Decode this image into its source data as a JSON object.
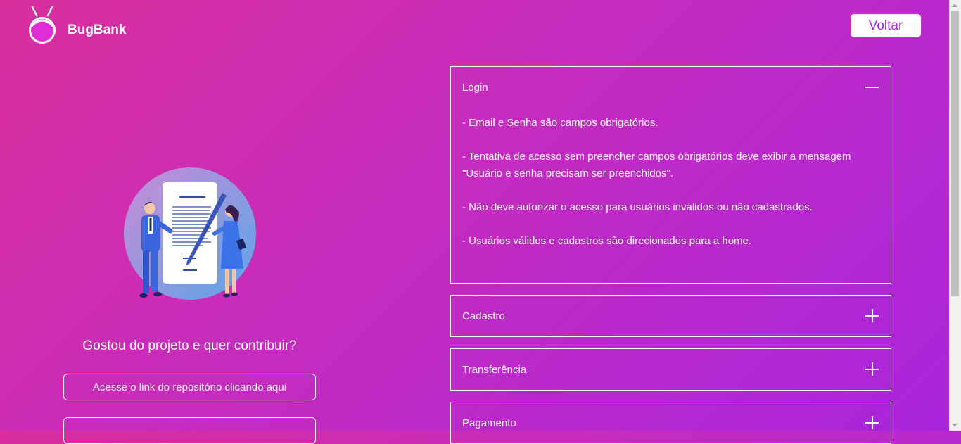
{
  "header": {
    "brand": "BugBank",
    "back_label": "Voltar"
  },
  "left": {
    "illustration": "document-signing-illustration",
    "contribute_title": "Gostou do projeto e quer contribuir?",
    "repo_link_label": "Acesse o link do repositório clicando aqui"
  },
  "accordion": [
    {
      "title": "Login",
      "expanded": true,
      "icon": "minus-icon",
      "items": [
        "- Email e Senha são campos obrigatórios.",
        "- Tentativa de acesso sem preencher campos obrigatórios deve exibir a mensagem \"Usuário e senha precisam ser preenchidos\".",
        "- Não deve autorizar o acesso para usuários inválidos ou não cadastrados.",
        "- Usuários válidos e cadastros são direcionados para a home."
      ]
    },
    {
      "title": "Cadastro",
      "expanded": false,
      "icon": "plus-icon"
    },
    {
      "title": "Transferência",
      "expanded": false,
      "icon": "plus-icon"
    },
    {
      "title": "Pagamento",
      "expanded": false,
      "icon": "plus-icon"
    }
  ],
  "colors": {
    "gradient_start": "#d92e9c",
    "gradient_end": "#a825dd",
    "button_text": "#a825dd"
  }
}
